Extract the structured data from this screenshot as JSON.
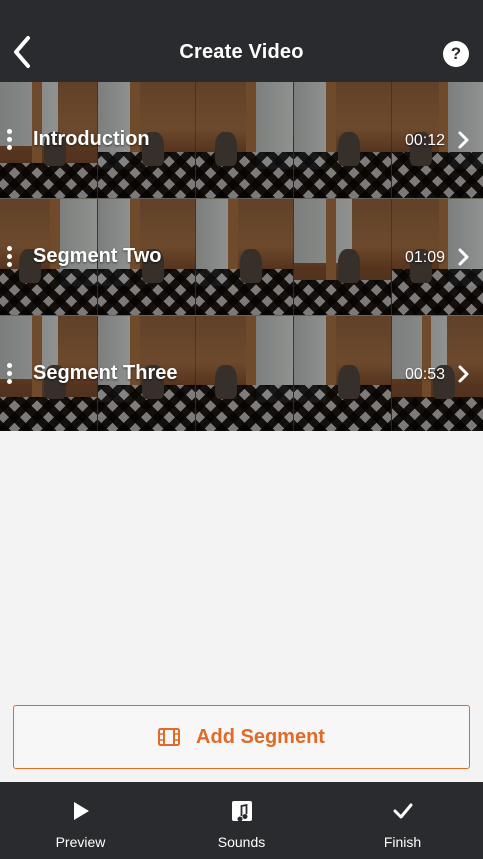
{
  "header": {
    "title": "Create Video",
    "help_label": "?"
  },
  "segments": [
    {
      "name": "Introduction",
      "duration": "00:12"
    },
    {
      "name": "Segment Two",
      "duration": "01:09"
    },
    {
      "name": "Segment Three",
      "duration": "00:53"
    }
  ],
  "add_segment": {
    "label": "Add Segment"
  },
  "tabs": [
    {
      "label": "Preview",
      "icon": "play-icon"
    },
    {
      "label": "Sounds",
      "icon": "music-note-icon"
    },
    {
      "label": "Finish",
      "icon": "checkmark-icon"
    }
  ],
  "colors": {
    "accent": "#e06a26",
    "header_bg": "#2a2b2e",
    "page_bg": "#f3f3f3"
  }
}
